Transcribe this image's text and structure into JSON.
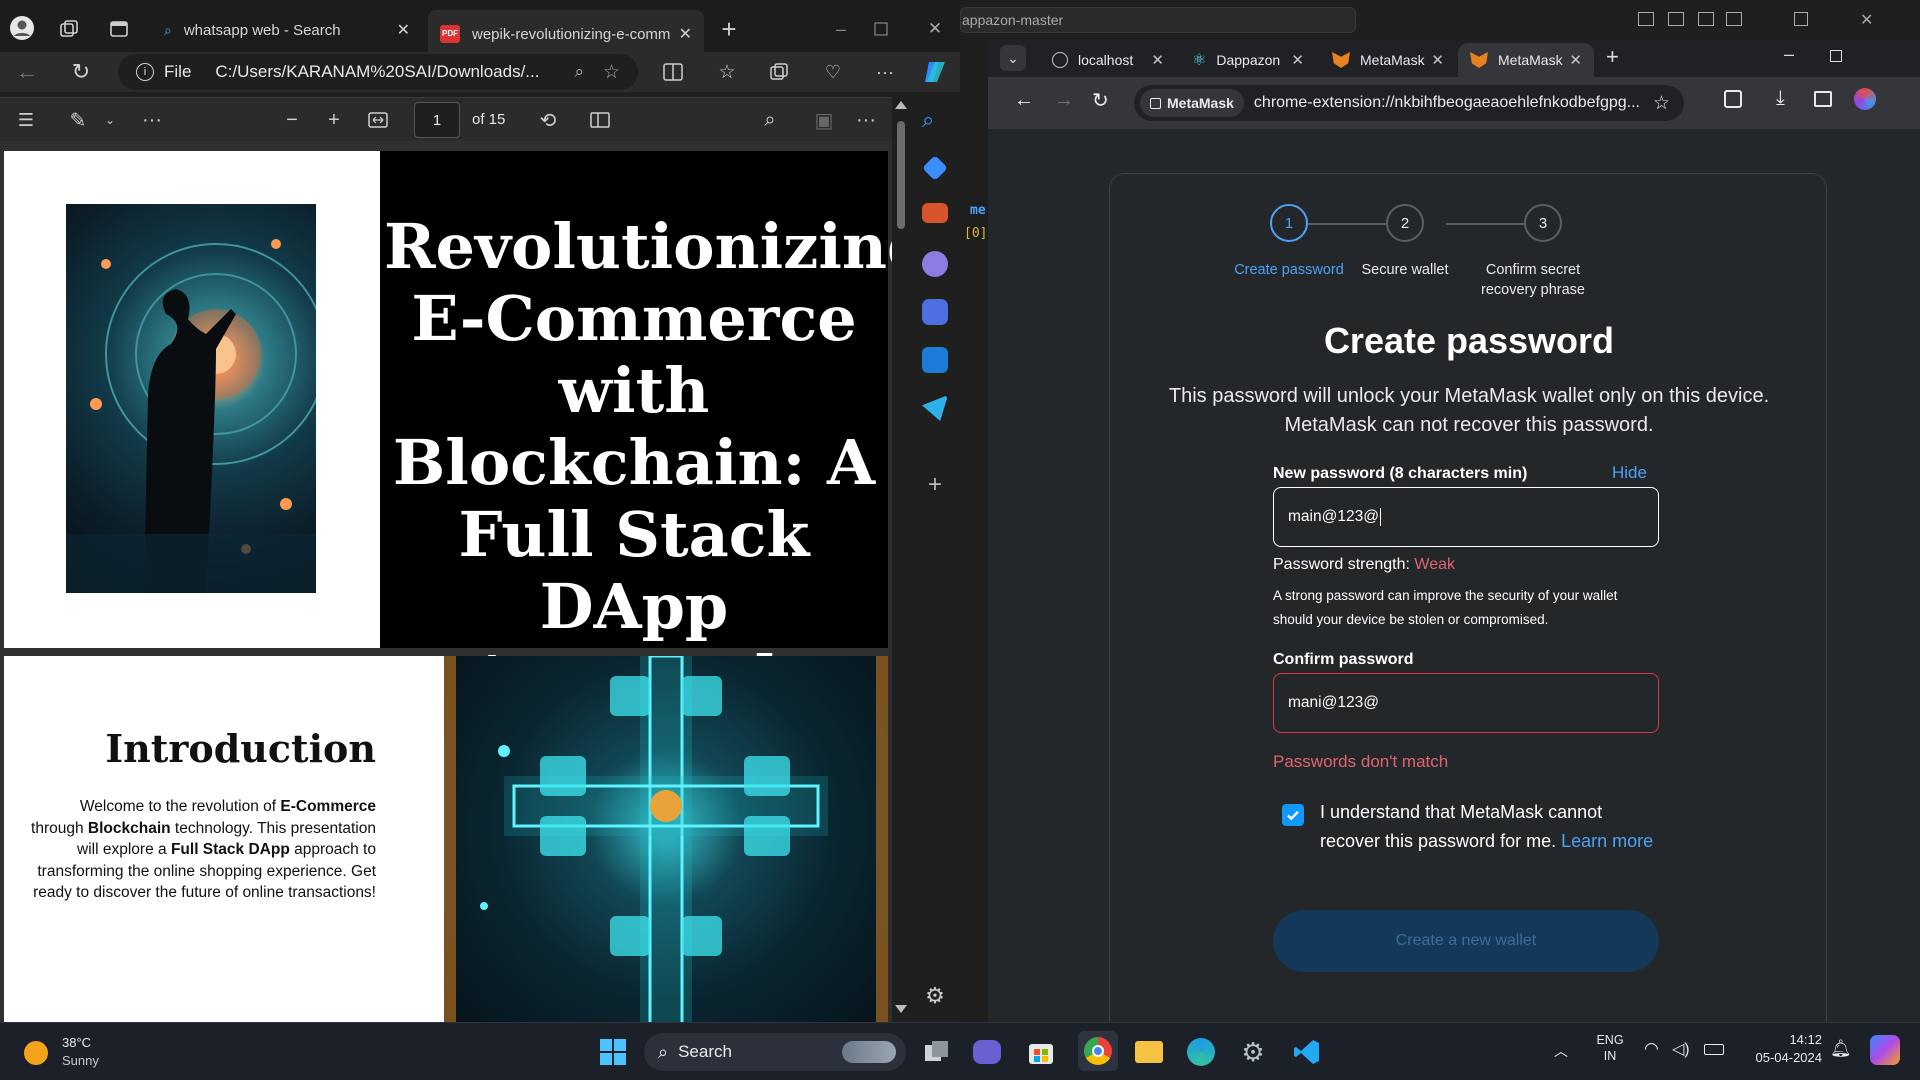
{
  "edge": {
    "tabs": [
      {
        "label": "whatsapp web - Search",
        "active": false
      },
      {
        "label": "wepik-revolutionizing-e-comm",
        "active": true
      }
    ],
    "url_scheme": "File",
    "url": "C:/Users/KARANAM%20SAI/Downloads/...",
    "pdf": {
      "page_current": "1",
      "page_total": "of 15"
    }
  },
  "slide1": {
    "title": "Revolutionizing E-Commerce with Blockchain: A Full Stack DApp Approach"
  },
  "slide2": {
    "heading": "Introduction",
    "body_parts": [
      {
        "t": "Welcome to the revolution of ",
        "b": false
      },
      {
        "t": "E-Commerce",
        "b": true
      },
      {
        "t": " through ",
        "b": false
      },
      {
        "t": "Blockchain",
        "b": true
      },
      {
        "t": " technology. This presentation will explore a ",
        "b": false
      },
      {
        "t": "Full Stack DApp",
        "b": true
      },
      {
        "t": " approach to transforming the online shopping experience. Get ready to discover the future of online transactions!",
        "b": false
      }
    ]
  },
  "terminal": {
    "title": "appazon-master",
    "line1": "me",
    "line2": "[0]"
  },
  "chrome": {
    "tabs": [
      {
        "label": "localhost",
        "active": false
      },
      {
        "label": "Dappazon",
        "active": false
      },
      {
        "label": "MetaMask",
        "active": false
      },
      {
        "label": "MetaMask",
        "active": true
      }
    ],
    "site_chip": "MetaMask",
    "url": "chrome-extension://nkbihfbeogaeaoehlefnkodbefgpg..."
  },
  "metamask": {
    "steps": [
      {
        "num": "1",
        "label": "Create password",
        "active": true
      },
      {
        "num": "2",
        "label": "Secure wallet",
        "active": false
      },
      {
        "num": "3",
        "label": "Confirm secret recovery phrase",
        "active": false
      }
    ],
    "title": "Create password",
    "description": "This password will unlock your MetaMask wallet only on this device. MetaMask can not recover this password.",
    "new_password_label": "New password (8 characters min)",
    "hide_label": "Hide",
    "new_password_value": "main@123@",
    "strength_label": "Password strength:",
    "strength_value": "Weak",
    "strength_help": "A strong password can improve the security of your wallet should your device be stolen or compromised.",
    "confirm_label": "Confirm password",
    "confirm_value": "mani@123@",
    "mismatch": "Passwords don't match",
    "checkbox_checked": true,
    "checkbox_text": "I understand that MetaMask cannot recover this password for me.",
    "learn_more": "Learn more",
    "create_button": "Create a new wallet"
  },
  "taskbar": {
    "weather_temp": "38°C",
    "weather_desc": "Sunny",
    "search_label": "Search",
    "lang1": "ENG",
    "lang2": "IN",
    "time": "14:12",
    "date": "05-04-2024"
  }
}
